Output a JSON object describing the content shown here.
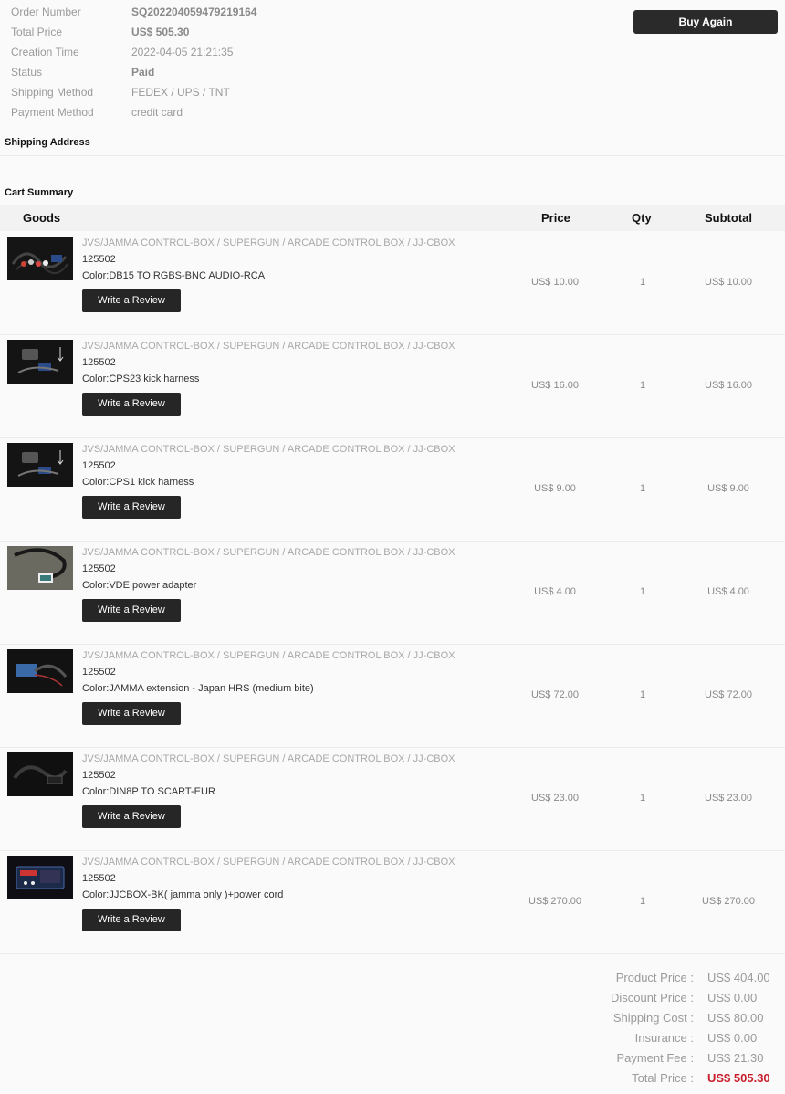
{
  "order": {
    "fields": [
      {
        "label": "Order Number",
        "value": "SQ202204059479219164",
        "bold": true
      },
      {
        "label": "Total Price",
        "value": "US$ 505.30",
        "bold": true
      },
      {
        "label": "Creation Time",
        "value": "2022-04-05 21:21:35",
        "bold": false
      },
      {
        "label": "Status",
        "value": "Paid",
        "bold": true
      },
      {
        "label": "Shipping Method",
        "value": "FEDEX / UPS / TNT",
        "bold": false
      },
      {
        "label": "Payment Method",
        "value": "credit card",
        "bold": false
      }
    ],
    "buy_again_label": "Buy Again"
  },
  "shipping_address": {
    "title": "Shipping Address"
  },
  "cart": {
    "title": "Cart Summary",
    "columns": {
      "goods": "Goods",
      "price": "Price",
      "qty": "Qty",
      "subtotal": "Subtotal"
    },
    "review_label": "Write a Review",
    "items": [
      {
        "name": "JVS/JAMMA CONTROL-BOX / SUPERGUN / ARCADE CONTROL BOX / JJ-CBOX",
        "sku": "125502",
        "color": "Color:DB15 TO RGBS-BNC AUDIO-RCA",
        "price": "US$ 10.00",
        "qty": "1",
        "subtotal": "US$ 10.00",
        "thumb": "cable-bundle"
      },
      {
        "name": "JVS/JAMMA CONTROL-BOX / SUPERGUN / ARCADE CONTROL BOX / JJ-CBOX",
        "sku": "125502",
        "color": "Color:CPS23 kick harness",
        "price": "US$ 16.00",
        "qty": "1",
        "subtotal": "US$ 16.00",
        "thumb": "kick-harness"
      },
      {
        "name": "JVS/JAMMA CONTROL-BOX / SUPERGUN / ARCADE CONTROL BOX / JJ-CBOX",
        "sku": "125502",
        "color": "Color:CPS1 kick harness",
        "price": "US$ 9.00",
        "qty": "1",
        "subtotal": "US$ 9.00",
        "thumb": "kick-harness"
      },
      {
        "name": "JVS/JAMMA CONTROL-BOX / SUPERGUN / ARCADE CONTROL BOX / JJ-CBOX",
        "sku": "125502",
        "color": "Color:VDE power adapter",
        "price": "US$ 4.00",
        "qty": "1",
        "subtotal": "US$ 4.00",
        "thumb": "power-adapter"
      },
      {
        "name": "JVS/JAMMA CONTROL-BOX / SUPERGUN / ARCADE CONTROL BOX / JJ-CBOX",
        "sku": "125502",
        "color": "Color:JAMMA extension - Japan HRS (medium bite)",
        "price": "US$ 72.00",
        "qty": "1",
        "subtotal": "US$ 72.00",
        "thumb": "extension"
      },
      {
        "name": "JVS/JAMMA CONTROL-BOX / SUPERGUN / ARCADE CONTROL BOX / JJ-CBOX",
        "sku": "125502",
        "color": "Color:DIN8P TO SCART-EUR",
        "price": "US$ 23.00",
        "qty": "1",
        "subtotal": "US$ 23.00",
        "thumb": "scart-cable"
      },
      {
        "name": "JVS/JAMMA CONTROL-BOX / SUPERGUN / ARCADE CONTROL BOX / JJ-CBOX",
        "sku": "125502",
        "color": "Color:JJCBOX-BK( jamma only )+power cord",
        "price": "US$ 270.00",
        "qty": "1",
        "subtotal": "US$ 270.00",
        "thumb": "control-box"
      }
    ]
  },
  "totals": [
    {
      "label": "Product Price :",
      "value": "US$ 404.00"
    },
    {
      "label": "Discount Price :",
      "value": "US$ 0.00"
    },
    {
      "label": "Shipping Cost :",
      "value": "US$ 80.00"
    },
    {
      "label": "Insurance :",
      "value": "US$ 0.00"
    },
    {
      "label": "Payment Fee :",
      "value": "US$ 21.30"
    },
    {
      "label": "Total Price :",
      "value": "US$ 505.30",
      "final": true
    }
  ]
}
